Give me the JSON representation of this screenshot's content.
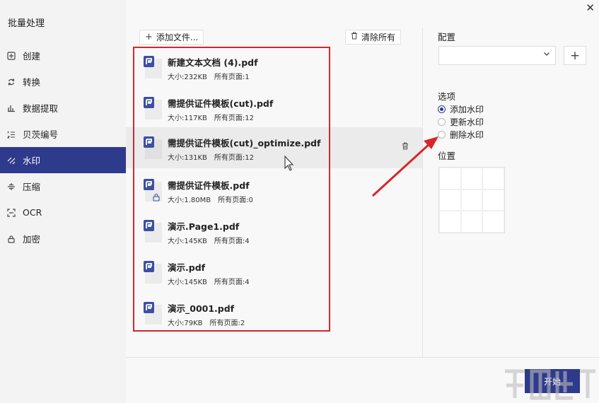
{
  "app": {
    "title": "批量处理",
    "close_icon": "✕"
  },
  "sidebar": {
    "items": [
      {
        "label": "创建",
        "icon": "create-icon"
      },
      {
        "label": "转换",
        "icon": "convert-icon"
      },
      {
        "label": "数据提取",
        "icon": "data-extract-icon"
      },
      {
        "label": "贝茨编号",
        "icon": "bates-number-icon"
      },
      {
        "label": "水印",
        "icon": "watermark-icon",
        "active": true
      },
      {
        "label": "压缩",
        "icon": "compress-icon"
      },
      {
        "label": "OCR",
        "icon": "ocr-icon"
      },
      {
        "label": "加密",
        "icon": "lock-icon"
      }
    ],
    "accent": "#2e3a8c"
  },
  "toolbar": {
    "add_files_label": "添加文件...",
    "clear_all_label": "清除所有"
  },
  "files": [
    {
      "name": "新建文本文档 (4).pdf",
      "size": "大小:232KB",
      "pages": "所有页面:1"
    },
    {
      "name": "需提供证件模板(cut).pdf",
      "size": "大小:117KB",
      "pages": "所有页面:12"
    },
    {
      "name": "需提供证件模板(cut)_optimize.pdf",
      "size": "大小:131KB",
      "pages": "所有页面:12",
      "hover": true
    },
    {
      "name": "需提供证件模板.pdf",
      "size": "大小:1.80MB",
      "pages": "所有页面:0",
      "locked": true
    },
    {
      "name": "演示.Page1.pdf",
      "size": "大小:145KB",
      "pages": "所有页面:4"
    },
    {
      "name": "演示.pdf",
      "size": "大小:145KB",
      "pages": "所有页面:4"
    },
    {
      "name": "演示_0001.pdf",
      "size": "大小:79KB",
      "pages": "所有页面:2"
    }
  ],
  "panel": {
    "config_label": "配置",
    "config_value": "",
    "options_label": "选项",
    "options": [
      {
        "label": "添加水印",
        "selected": true
      },
      {
        "label": "更新水印",
        "selected": false
      },
      {
        "label": "删除水印",
        "selected": false
      }
    ],
    "position_label": "位置"
  },
  "footer": {
    "start_label": "开始"
  },
  "colors": {
    "highlight": "#d6262c",
    "accent": "#2e3a8c"
  }
}
